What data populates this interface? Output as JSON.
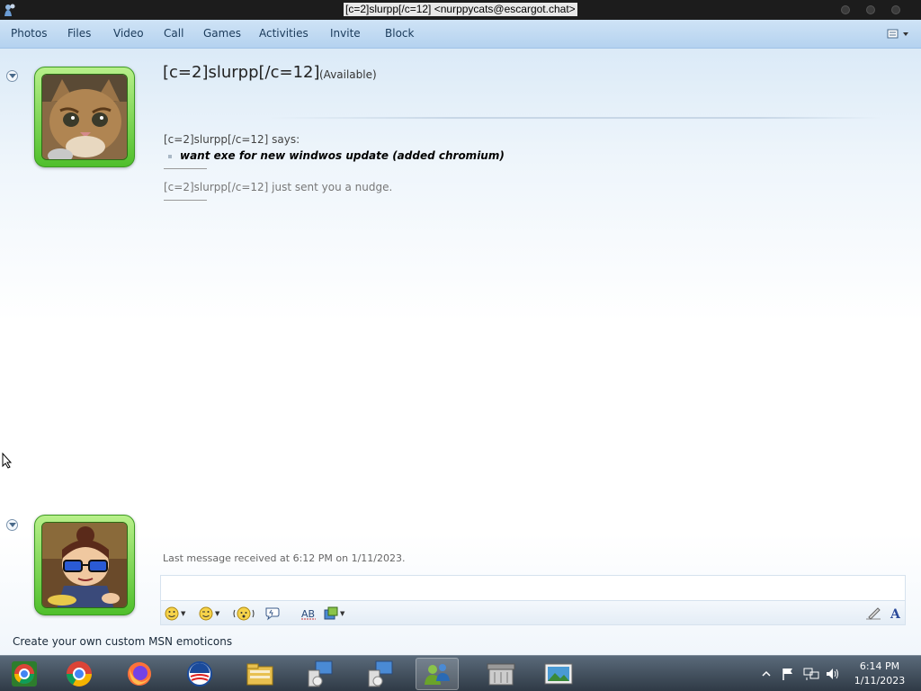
{
  "window": {
    "title": "[c=2]slurpp[/c=12] <nurppycats@escargot.chat>"
  },
  "menu": {
    "items": [
      "Photos",
      "Files",
      "Video",
      "Call",
      "Games",
      "Activities",
      "Invite",
      "Block"
    ]
  },
  "contact": {
    "name": "[c=2]slurpp[/c=12]",
    "status": "(Available)",
    "avatar": "kitten-photo",
    "presence_color": "#4fbf2b"
  },
  "conversation": {
    "sender_line": "[c=2]slurpp[/c=12] says:",
    "message": "want exe for new windwos update (added chromium)",
    "nudge_line": "[c=2]slurpp[/c=12] just sent you a nudge.",
    "last_received": "Last message received at 6:12 PM on 1/11/2023."
  },
  "self": {
    "avatar": "cartoon-character-with-sunglasses"
  },
  "compose": {
    "input_value": "",
    "toolbar": [
      "emoticon-icon",
      "wink-icon",
      "nudge-icon",
      "voice-clip-icon",
      "spellcheck-icon",
      "background-icon",
      "handwriting-icon",
      "font-icon"
    ]
  },
  "footer": {
    "promo": "Create your own custom MSN emoticons"
  },
  "taskbar": {
    "apps": [
      "chromium-icon",
      "chrome-icon",
      "firefox-icon",
      "obama-logo-icon",
      "file-explorer-icon",
      "network-setup-icon",
      "network-setup-icon",
      "messenger-icon",
      "archive-icon",
      "picture-viewer-icon"
    ],
    "clock_time": "6:14 PM",
    "clock_date": "1/11/2023"
  }
}
